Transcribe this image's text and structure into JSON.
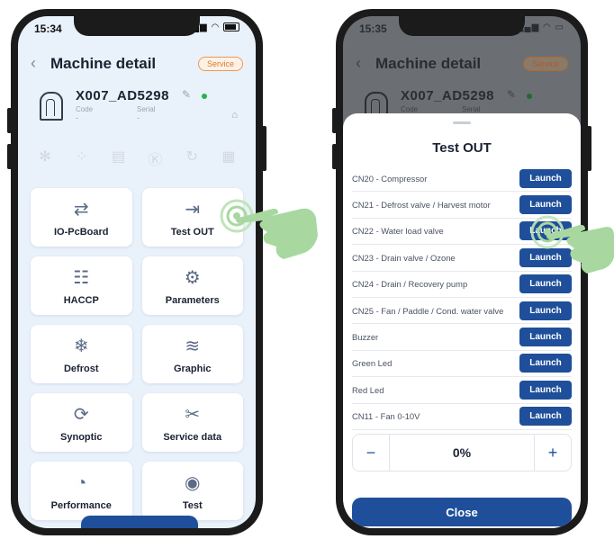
{
  "left_screen": {
    "status": {
      "time": "15:34",
      "signal": "..ll",
      "wifi": "wifi"
    },
    "header": {
      "back_icon": "chevron-left-icon",
      "title": "Machine detail",
      "badge": "Service"
    },
    "machine": {
      "name": "X007_AD5298",
      "code_label": "Code",
      "code_value": "-",
      "serial_label": "Serial",
      "serial_value": "-"
    },
    "state_icons": [
      "snowflake-icon",
      "drops-icon",
      "document-icon",
      "kg-icon",
      "refresh-icon",
      "calendar-icon"
    ],
    "tiles": [
      {
        "label": "IO-PcBoard",
        "icon": "arrows-circle-icon",
        "glyph": "⇄"
      },
      {
        "label": "Test OUT",
        "icon": "arrow-in-circle-icon",
        "glyph": "⇥"
      },
      {
        "label": "HACCP",
        "icon": "document-check-icon",
        "glyph": "☷"
      },
      {
        "label": "Parameters",
        "icon": "gears-icon",
        "glyph": "⚙"
      },
      {
        "label": "Defrost",
        "icon": "snowflake-drops-icon",
        "glyph": "❄"
      },
      {
        "label": "Graphic",
        "icon": "chart-icon",
        "glyph": "≋"
      },
      {
        "label": "Synoptic",
        "icon": "cycle-icon",
        "glyph": "⟳"
      },
      {
        "label": "Service data",
        "icon": "tools-icon",
        "glyph": "✂"
      },
      {
        "label": "Performance",
        "icon": "gauge-icon",
        "glyph": "◔"
      },
      {
        "label": "Test",
        "icon": "eye-icon",
        "glyph": "◉"
      }
    ]
  },
  "right_screen": {
    "status": {
      "time": "15:35"
    },
    "header": {
      "title": "Machine detail",
      "badge": "Service"
    },
    "machine": {
      "name": "X007_AD5298",
      "code_label": "Code",
      "serial_label": "Serial"
    },
    "sheet": {
      "title": "Test OUT",
      "rows": [
        {
          "label": "CN20 - Compressor",
          "button": "Launch"
        },
        {
          "label": "CN21 - Defrost valve / Harvest motor",
          "button": "Launch"
        },
        {
          "label": "CN22 - Water load valve",
          "button": "Launch"
        },
        {
          "label": "CN23 - Drain valve / Ozone",
          "button": "Launch"
        },
        {
          "label": "CN24 - Drain / Recovery pump",
          "button": "Launch"
        },
        {
          "label": "CN25 - Fan / Paddle / Cond. water valve",
          "button": "Launch"
        },
        {
          "label": "Buzzer",
          "button": "Launch"
        },
        {
          "label": "Green Led",
          "button": "Launch"
        },
        {
          "label": "Red Led",
          "button": "Launch"
        },
        {
          "label": "CN11 - Fan 0-10V",
          "button": "Launch"
        }
      ],
      "stepper": {
        "minus": "−",
        "value": "0%",
        "plus": "+"
      },
      "close_label": "Close"
    }
  },
  "colors": {
    "primary": "#1f4f9a",
    "badge": "#e07a2a",
    "hand": "#a8d8a0",
    "online": "#29b34a"
  }
}
